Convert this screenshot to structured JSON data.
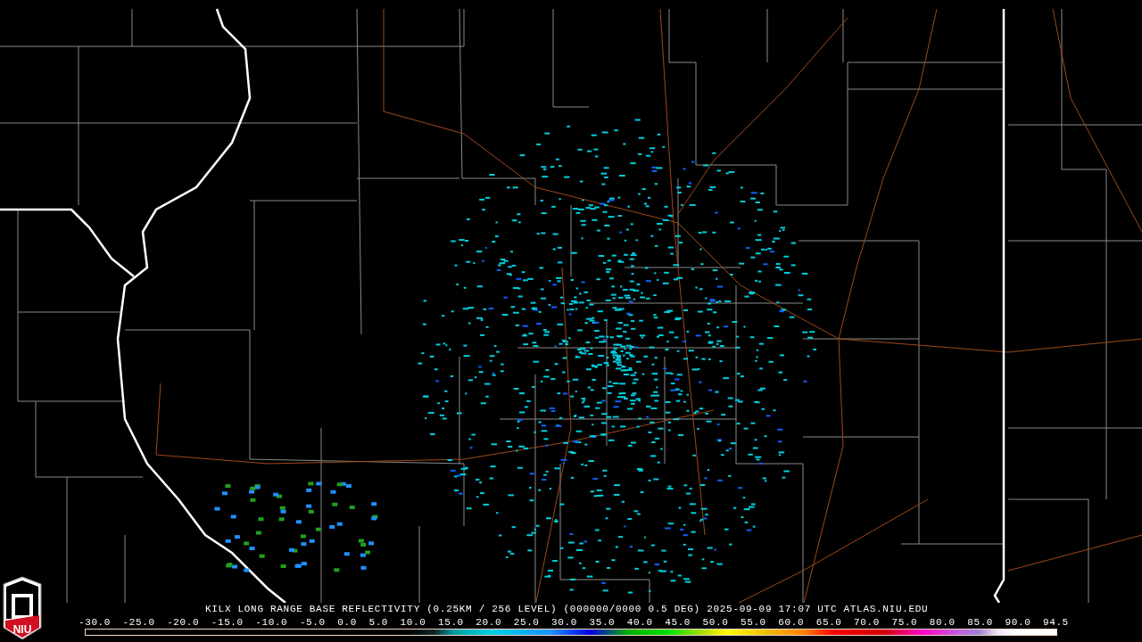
{
  "map": {
    "title": "KILX LONG RANGE BASE REFLECTIVITY (0.25KM / 256 LEVEL) (000000/0000 0.5 DEG) 2025-09-09 17:07 UTC  ATLAS.NIU.EDU"
  },
  "logo": {
    "text": "NIU"
  },
  "legend": {
    "ticks": [
      "-30.0",
      "-25.0",
      "-20.0",
      "-15.0",
      "-10.0",
      "-5.0",
      "0.0",
      "5.0",
      "10.0",
      "15.0",
      "20.0",
      "25.0",
      "30.0",
      "35.0",
      "40.0",
      "45.0",
      "50.0",
      "55.0",
      "60.0",
      "65.0",
      "70.0",
      "75.0",
      "80.0",
      "85.0",
      "90.0",
      "94.5"
    ]
  }
}
